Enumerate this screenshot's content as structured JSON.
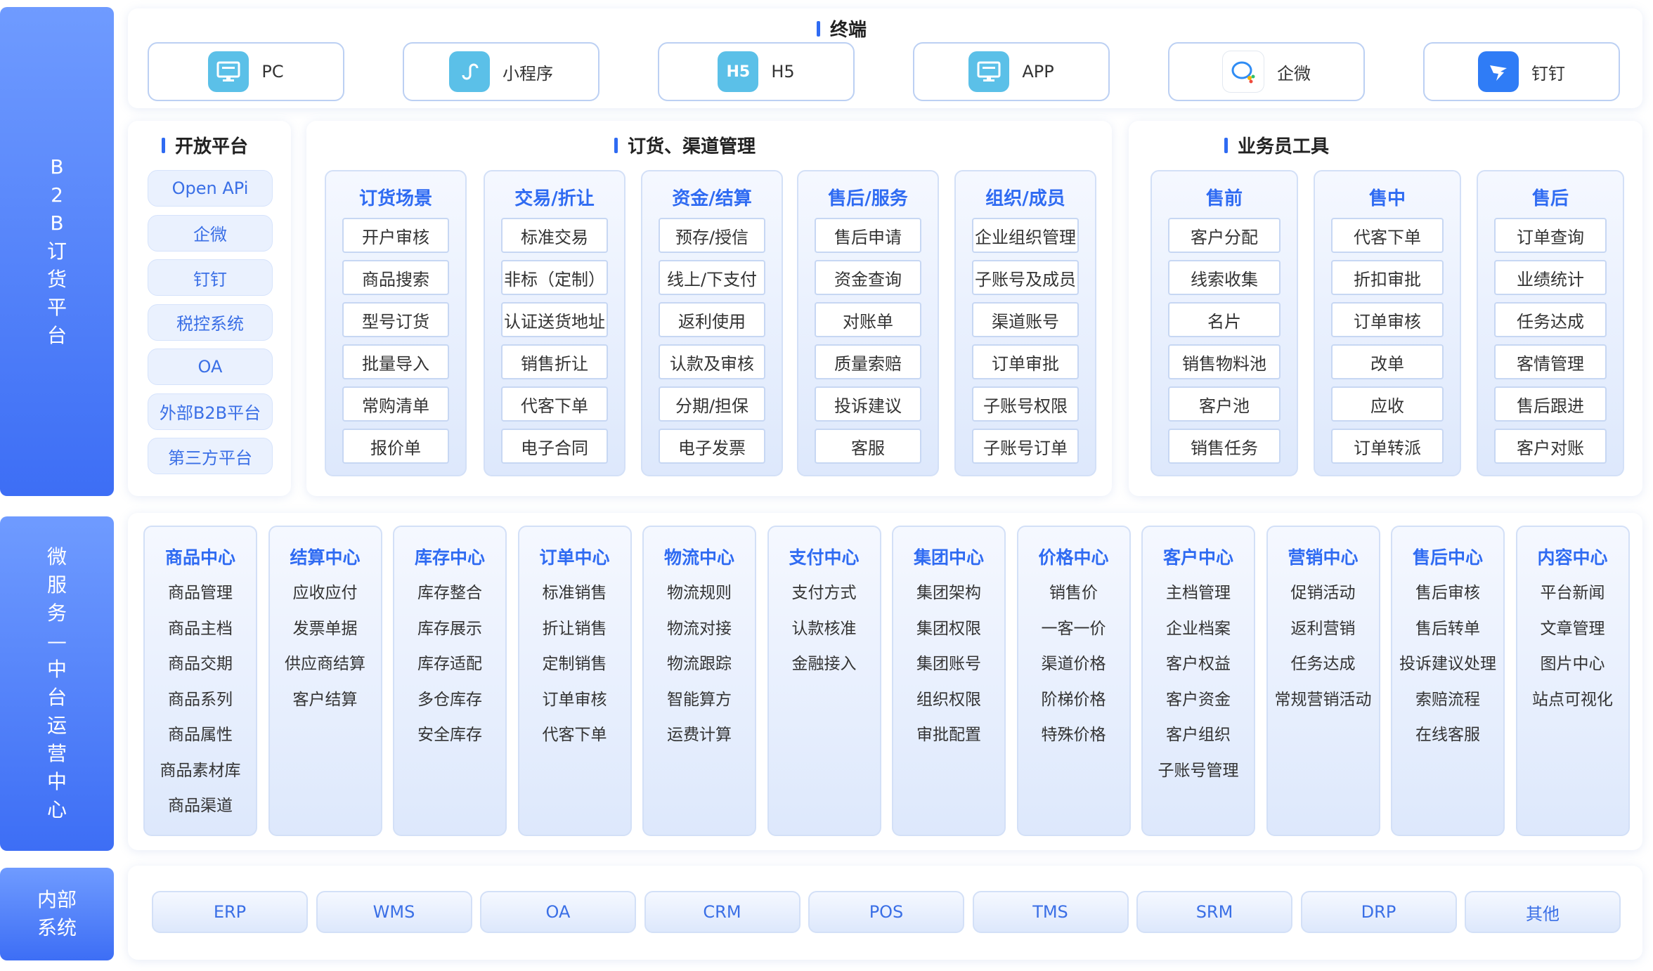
{
  "sidebar": {
    "b2b": "B\n2\nB\n订\n货\n平\n台",
    "micro": "微\n服\n务\n—\n中\n台\n运\n营\n中\n心",
    "internal": "内部\n系统"
  },
  "terminal": {
    "title": "终端",
    "items": [
      {
        "label": "PC",
        "icon": "monitor-icon",
        "icon_text": "",
        "color": "#5bc0e8"
      },
      {
        "label": "小程序",
        "icon": "mini-program-icon",
        "icon_text": "",
        "color": "#5bc0e8"
      },
      {
        "label": "H5",
        "icon": "h5-icon",
        "icon_text": "H5",
        "color": "#5bc0e8"
      },
      {
        "label": "APP",
        "icon": "monitor-icon",
        "icon_text": "",
        "color": "#5bc0e8"
      },
      {
        "label": "企微",
        "icon": "wecom-icon",
        "icon_text": "",
        "color": "#ffffff"
      },
      {
        "label": "钉钉",
        "icon": "dingtalk-icon",
        "icon_text": "",
        "color": "#2f7cf6"
      }
    ]
  },
  "open_platform": {
    "title": "开放平台",
    "items": [
      "Open APi",
      "企微",
      "钉钉",
      "税控系统",
      "OA",
      "外部B2B平台",
      "第三方平台"
    ]
  },
  "ordering": {
    "title": "订货、渠道管理",
    "cards": [
      {
        "title": "订货场景",
        "items": [
          "开户审核",
          "商品搜索",
          "型号订货",
          "批量导入",
          "常购清单",
          "报价单"
        ]
      },
      {
        "title": "交易/折让",
        "items": [
          "标准交易",
          "非标（定制）",
          "认证送货地址",
          "销售折让",
          "代客下单",
          "电子合同"
        ]
      },
      {
        "title": "资金/结算",
        "items": [
          "预存/授信",
          "线上/下支付",
          "返利使用",
          "认款及审核",
          "分期/担保",
          "电子发票"
        ]
      },
      {
        "title": "售后/服务",
        "items": [
          "售后申请",
          "资金查询",
          "对账单",
          "质量索赔",
          "投诉建议",
          "客服"
        ]
      },
      {
        "title": "组织/成员",
        "items": [
          "企业组织管理",
          "子账号及成员",
          "渠道账号",
          "订单审批",
          "子账号权限",
          "子账号订单"
        ]
      }
    ]
  },
  "sales_tools": {
    "title": "业务员工具",
    "cards": [
      {
        "title": "售前",
        "items": [
          "客户分配",
          "线索收集",
          "名片",
          "销售物料池",
          "客户池",
          "销售任务"
        ]
      },
      {
        "title": "售中",
        "items": [
          "代客下单",
          "折扣审批",
          "订单审核",
          "改单",
          "应收",
          "订单转派"
        ]
      },
      {
        "title": "售后",
        "items": [
          "订单查询",
          "业绩统计",
          "任务达成",
          "客情管理",
          "售后跟进",
          "客户对账"
        ]
      }
    ]
  },
  "micro_services": [
    {
      "title": "商品中心",
      "items": [
        "商品管理",
        "商品主档",
        "商品交期",
        "商品系列",
        "商品属性",
        "商品素材库",
        "商品渠道"
      ]
    },
    {
      "title": "结算中心",
      "items": [
        "应收应付",
        "发票单据",
        "供应商结算",
        "客户结算"
      ]
    },
    {
      "title": "库存中心",
      "items": [
        "库存整合",
        "库存展示",
        "库存适配",
        "多仓库存",
        "安全库存"
      ]
    },
    {
      "title": "订单中心",
      "items": [
        "标准销售",
        "折让销售",
        "定制销售",
        "订单审核",
        "代客下单"
      ]
    },
    {
      "title": "物流中心",
      "items": [
        "物流规则",
        "物流对接",
        "物流跟踪",
        "智能算方",
        "运费计算"
      ]
    },
    {
      "title": "支付中心",
      "items": [
        "支付方式",
        "认款核准",
        "金融接入"
      ]
    },
    {
      "title": "集团中心",
      "items": [
        "集团架构",
        "集团权限",
        "集团账号",
        "组织权限",
        "审批配置"
      ]
    },
    {
      "title": "价格中心",
      "items": [
        "销售价",
        "一客一价",
        "渠道价格",
        "阶梯价格",
        "特殊价格"
      ]
    },
    {
      "title": "客户中心",
      "items": [
        "主档管理",
        "企业档案",
        "客户权益",
        "客户资金",
        "客户组织",
        "子账号管理"
      ]
    },
    {
      "title": "营销中心",
      "items": [
        "促销活动",
        "返利营销",
        "任务达成",
        "常规营销活动"
      ]
    },
    {
      "title": "售后中心",
      "items": [
        "售后审核",
        "售后转单",
        "投诉建议处理",
        "索赔流程",
        "在线客服"
      ]
    },
    {
      "title": "内容中心",
      "items": [
        "平台新闻",
        "文章管理",
        "图片中心",
        "站点可视化"
      ]
    }
  ],
  "internal_systems": [
    "ERP",
    "WMS",
    "OA",
    "CRM",
    "POS",
    "TMS",
    "SRM",
    "DRP",
    "其他"
  ],
  "colors": {
    "accent": "#2f6bf2",
    "sidebar": "#4a7cf7"
  }
}
